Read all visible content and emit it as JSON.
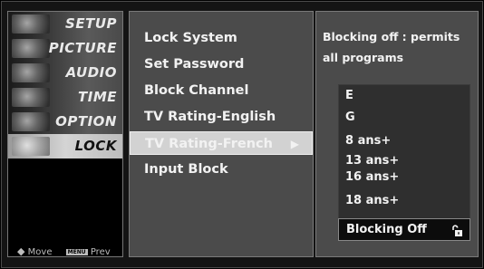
{
  "categories": [
    {
      "label": "SETUP",
      "icon": "satellite-dish-icon"
    },
    {
      "label": "PICTURE",
      "icon": "picture-icon"
    },
    {
      "label": "AUDIO",
      "icon": "speaker-icon"
    },
    {
      "label": "TIME",
      "icon": "clock-icon"
    },
    {
      "label": "OPTION",
      "icon": "option-icon"
    },
    {
      "label": "LOCK",
      "icon": "lock-icon",
      "active": true
    }
  ],
  "hints": {
    "move_icon": "◆",
    "move_label": "Move",
    "prev_badge": "MENU",
    "prev_label": "Prev"
  },
  "menu_items": [
    {
      "label": "Lock System"
    },
    {
      "label": "Set Password"
    },
    {
      "label": "Block Channel"
    },
    {
      "label": "TV Rating-English"
    },
    {
      "label": "TV Rating-French",
      "selected": true,
      "arrow": "▶"
    },
    {
      "label": "Input Block"
    }
  ],
  "detail": {
    "description": "Blocking off : permits all programs",
    "ratings": [
      "E",
      "G",
      "8 ans+",
      "13 ans+",
      "16 ans+",
      "18 ans+"
    ],
    "current": "Blocking Off",
    "current_icon": "unlocked-padlock-icon"
  },
  "colors": {
    "panel": "#4b4b4b",
    "selected": "#d2d2d2",
    "active_category": "#c8c8c8",
    "text": "#f2f2f2"
  }
}
